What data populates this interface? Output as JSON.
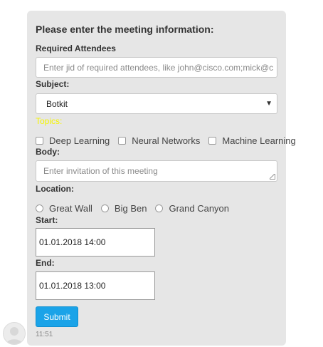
{
  "form": {
    "heading": "Please enter the meeting information:",
    "attendees": {
      "label": "Required Attendees",
      "placeholder": "Enter jid of required attendees, like john@cisco.com;mick@c"
    },
    "subject": {
      "label": "Subject:",
      "selected": "Botkit"
    },
    "topics": {
      "label": "Topics:",
      "options": [
        "Deep Learning",
        "Neural Networks",
        "Machine Learning"
      ]
    },
    "body": {
      "label": "Body:",
      "placeholder": "Enter invitation of this meeting"
    },
    "location": {
      "label": "Location:",
      "options": [
        "Great Wall",
        "Big Ben",
        "Grand Canyon"
      ]
    },
    "start": {
      "label": "Start:",
      "value": "01.01.2018 14:00"
    },
    "end": {
      "label": "End:",
      "value": "01.01.2018 13:00"
    },
    "submit_label": "Submit",
    "timestamp": "11:51"
  },
  "colors": {
    "card_bg": "#e6e6e6",
    "topics_label": "#f5f500",
    "button": "#1aa3e8"
  }
}
